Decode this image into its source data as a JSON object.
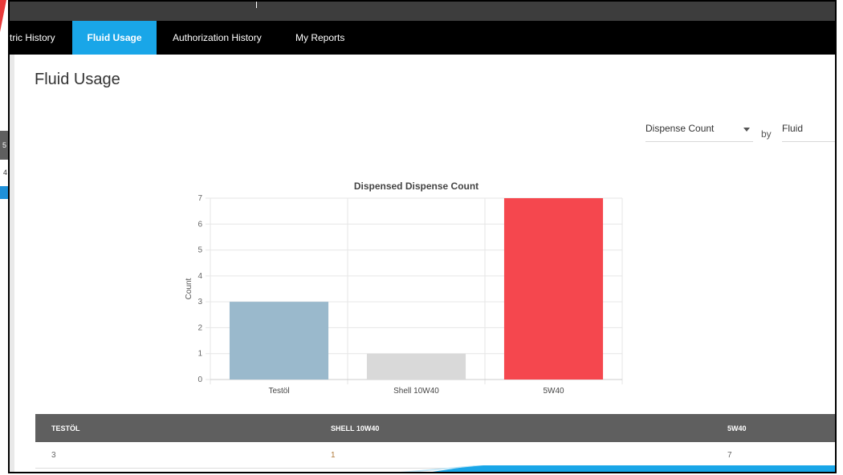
{
  "background": {
    "behind_row_1": "5",
    "behind_row_2": "4"
  },
  "nav": {
    "tabs": [
      {
        "label": "tric History",
        "active": false
      },
      {
        "label": "Fluid Usage",
        "active": true
      },
      {
        "label": "Authorization History",
        "active": false
      },
      {
        "label": "My Reports",
        "active": false
      }
    ]
  },
  "page": {
    "title": "Fluid Usage"
  },
  "controls": {
    "metric": "Dispense Count",
    "by_label": "by",
    "group_by": "Fluid"
  },
  "chart_data": {
    "type": "bar",
    "title": "Dispensed Dispense Count",
    "ylabel": "Count",
    "xlabel": "",
    "categories": [
      "Testöl",
      "Shell 10W40",
      "5W40"
    ],
    "values": [
      3,
      1,
      7
    ],
    "colors": [
      "#9ab9cc",
      "#d9d9d9",
      "#f5474e"
    ],
    "ylim": [
      0,
      7
    ],
    "yticks": [
      "0",
      "1",
      "2",
      "3",
      "4",
      "5",
      "6",
      "7"
    ],
    "grid": true,
    "legend": "none"
  },
  "table": {
    "headers": [
      "TESTÖL",
      "SHELL 10W40",
      "5W40"
    ],
    "row": [
      "3",
      "1",
      "7"
    ]
  },
  "colors": {
    "accent": "#19a6e8",
    "navbar": "#000000",
    "table_header": "#5f5f5f"
  }
}
